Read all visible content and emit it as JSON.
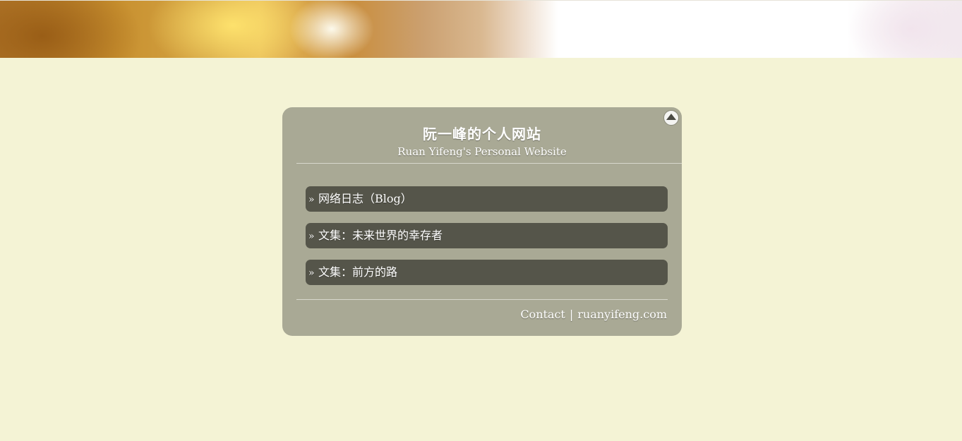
{
  "site": {
    "title_cn": "阮一峰的个人网站",
    "title_en": "Ruan Yifeng's Personal Website"
  },
  "menu": {
    "bullet": "»",
    "items": [
      {
        "label": "网络日志（Blog）"
      },
      {
        "label": "文集：未来世界的幸存者"
      },
      {
        "label": "文集：前方的路"
      }
    ]
  },
  "footer": {
    "contact": "Contact",
    "separator": "|",
    "domain": "ruanyifeng.com"
  },
  "colors": {
    "page_background": "#f4f3d5",
    "card_background": "#a9a995",
    "menu_item_background": "#55554a",
    "text": "#ffffff"
  },
  "icons": {
    "collapse": "triangle-up-icon"
  }
}
